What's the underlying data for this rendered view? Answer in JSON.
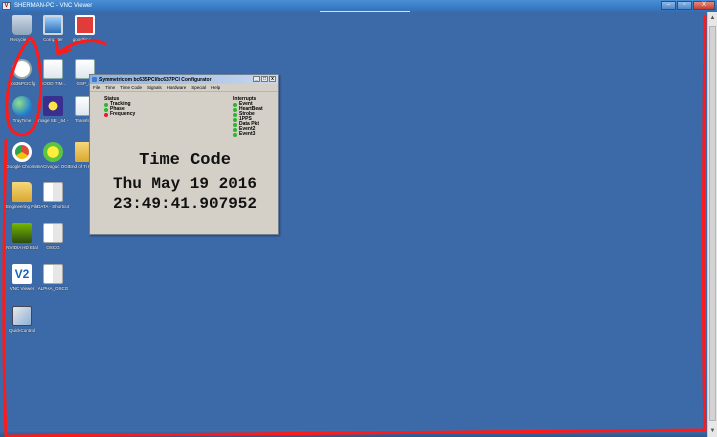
{
  "viewer": {
    "title": "SHERMAN-PC - VNC Viewer",
    "controls": {
      "minimize": "–",
      "maximize": "▫",
      "close": "X"
    }
  },
  "desktop_icons": [
    {
      "label": "Recycle Bin",
      "icon": "recycle-bin-icon"
    },
    {
      "label": "Computer",
      "icon": "computer-icon"
    },
    {
      "label": "goodtime_...",
      "icon": "app-icon"
    },
    {
      "label": "bc635PCICfg",
      "icon": "clock-icon"
    },
    {
      "label": "GOOD TIM...",
      "icon": "document-icon"
    },
    {
      "label": "GSP_rtc",
      "icon": "monitor-icon"
    },
    {
      "label": "TrayTime",
      "icon": "globe-icon"
    },
    {
      "label": "Image SE _64 - Sac...",
      "icon": "star-icon"
    },
    {
      "label": "Transfer...",
      "icon": "monitor-icon"
    },
    {
      "label": "Google Chrome",
      "icon": "chrome-icon"
    },
    {
      "label": "SACIvoguc OGS",
      "icon": "sun-icon"
    },
    {
      "label": "End of Ti File Trai",
      "icon": "folder-icon"
    },
    {
      "label": "Engineering Files",
      "icon": "folder-icon"
    },
    {
      "label": "DATA - Shortcut",
      "icon": "book-icon"
    },
    {
      "label": "NVIDIA HD Etal",
      "icon": "nvidia-icon"
    },
    {
      "label": "OSCG",
      "icon": "book-icon"
    },
    {
      "label": "VNC Viewer",
      "icon": "vnc-icon"
    },
    {
      "label": "ALPHA_OSCG",
      "icon": "book-icon"
    },
    {
      "label": "QuickControl",
      "icon": "quickcontrol-icon"
    }
  ],
  "app": {
    "title": "Symmetricom bc635PCI/bc637PCI Configurator",
    "menu": [
      "File",
      "Time",
      "Time Code",
      "Signals",
      "Hardware",
      "Special",
      "Help"
    ],
    "status_header": "Status",
    "status": [
      {
        "label": "Tracking",
        "color": "#2fb42f"
      },
      {
        "label": "Phase",
        "color": "#2fb42f"
      },
      {
        "label": "Frequency",
        "color": "#dd2222"
      }
    ],
    "interrupts_header": "Interrupts",
    "interrupts": [
      "Event",
      "HeartBeat",
      "Strobe",
      "1PPS",
      "Data Pkt",
      "Event2",
      "Event3"
    ],
    "time_code_label": "Time Code",
    "date": "Thu May 19 2016",
    "time": "23:49:41.907952"
  },
  "colors": {
    "desktop": "#3c6aa8",
    "annotation": "#ff1a1a"
  }
}
